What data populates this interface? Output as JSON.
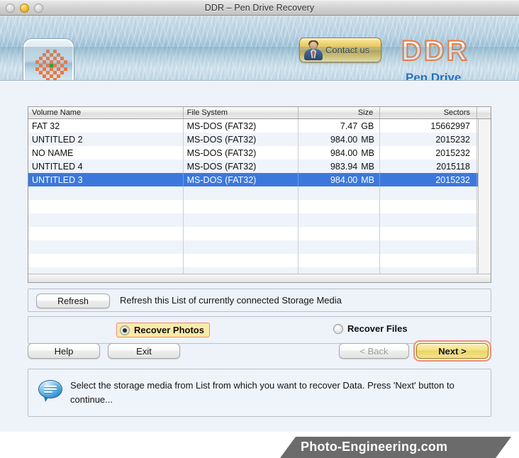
{
  "window": {
    "title": "DDR – Pen Drive Recovery",
    "traffic_lights": [
      "close-disabled",
      "minimize-active",
      "zoom-disabled"
    ]
  },
  "header": {
    "app_icon": "checkered-flower-icon",
    "contact_button": {
      "label": "Contact us",
      "icon": "person-avatar-icon"
    },
    "logo_primary": "DDR",
    "logo_secondary": "Pen Drive",
    "logo_primary_color": "#f4762f",
    "logo_secondary_color": "#1f6fc4"
  },
  "table": {
    "columns": [
      "Volume Name",
      "File System",
      "Size",
      "Sectors"
    ],
    "rows": [
      {
        "volume": "FAT 32",
        "fs": "MS-DOS (FAT32)",
        "size": "7.47",
        "unit": "GB",
        "sectors": "15662997",
        "selected": false
      },
      {
        "volume": "UNTITLED 2",
        "fs": "MS-DOS (FAT32)",
        "size": "984.00",
        "unit": "MB",
        "sectors": "2015232",
        "selected": false
      },
      {
        "volume": "NO NAME",
        "fs": "MS-DOS (FAT32)",
        "size": "984.00",
        "unit": "MB",
        "sectors": "2015232",
        "selected": false
      },
      {
        "volume": "UNTITLED 4",
        "fs": "MS-DOS (FAT32)",
        "size": "983.94",
        "unit": "MB",
        "sectors": "2015118",
        "selected": false
      },
      {
        "volume": "UNTITLED 3",
        "fs": "MS-DOS (FAT32)",
        "size": "984.00",
        "unit": "MB",
        "sectors": "2015232",
        "selected": true
      }
    ],
    "empty_row_count": 8,
    "selection_color": "#3c78dc"
  },
  "refresh": {
    "button_label": "Refresh",
    "description": "Refresh this List of currently connected Storage Media"
  },
  "mode": {
    "options": [
      {
        "label": "Recover Photos",
        "selected": true
      },
      {
        "label": "Recover Files",
        "selected": false
      }
    ],
    "highlight_bg": "#fbeaa8",
    "highlight_border": "#e88a78"
  },
  "buttons": {
    "help": "Help",
    "exit": "Exit",
    "back": "< Back",
    "next": "Next >",
    "back_disabled": true,
    "next_focus_ring": "#ef8e7f"
  },
  "message": {
    "icon": "speech-bubble-icon",
    "text": "Select the storage media from List from which you want to recover Data. Press 'Next' button to continue..."
  },
  "footer": {
    "watermark": "Photo-Engineering.com",
    "band_color": "#6b6b6b"
  }
}
